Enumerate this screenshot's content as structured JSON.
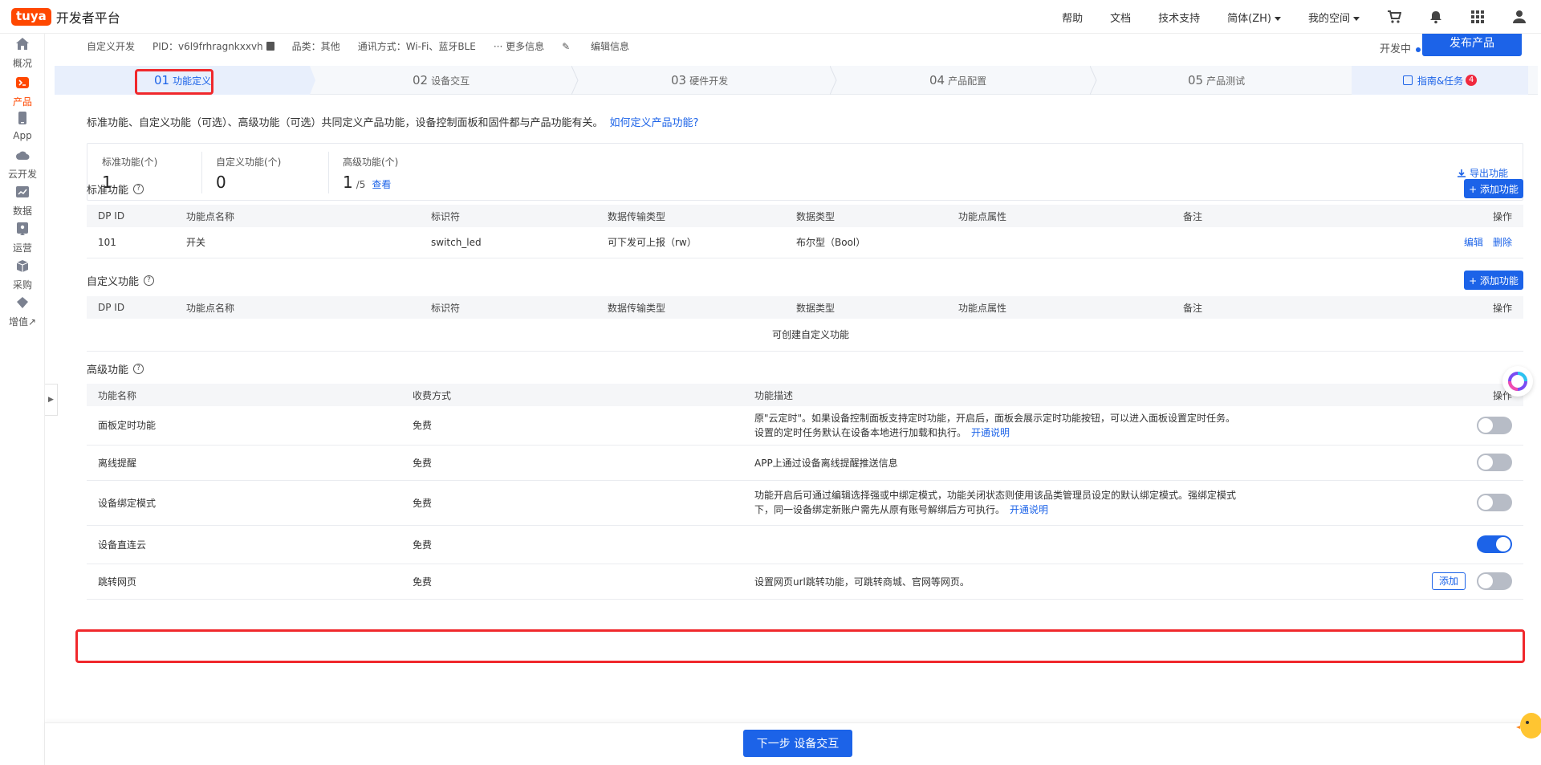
{
  "app": {
    "logo": "tuya",
    "title": "开发者平台"
  },
  "topnav": {
    "items": [
      "帮助",
      "文档",
      "技术支持",
      "简体(ZH)",
      "我的空间"
    ],
    "icons": [
      "cart-icon",
      "bell-icon",
      "apps-grid-icon",
      "user-icon"
    ]
  },
  "sidebar": {
    "items": [
      {
        "label": "概况",
        "icon": "home-icon"
      },
      {
        "label": "产品",
        "icon": "terminal-icon",
        "active": true
      },
      {
        "label": "App",
        "icon": "phone-icon"
      },
      {
        "label": "云开发",
        "icon": "cloud-icon"
      },
      {
        "label": "数据",
        "icon": "chart-icon"
      },
      {
        "label": "运营",
        "icon": "location-icon"
      },
      {
        "label": "采购",
        "icon": "box-icon"
      },
      {
        "label": "增值↗",
        "icon": "diamond-icon"
      }
    ]
  },
  "meta": {
    "dev_type": "自定义开发",
    "pid": "PID：v6l9frhragnkxxvh",
    "category": "品类：其他",
    "comm": "通讯方式：Wi-Fi、蓝牙BLE",
    "more": "··· 更多信息",
    "edit": "编辑信息",
    "status": "开发中",
    "publish": "发布产品"
  },
  "steps": [
    {
      "num": "01",
      "label": "功能定义",
      "active": true
    },
    {
      "num": "02",
      "label": "设备交互"
    },
    {
      "num": "03",
      "label": "硬件开发"
    },
    {
      "num": "04",
      "label": "产品配置"
    },
    {
      "num": "05",
      "label": "产品测试"
    }
  ],
  "guide": {
    "label": "指南&任务",
    "badge": "4"
  },
  "intro": {
    "text": "标准功能、自定义功能（可选）、高级功能（可选）共同定义产品功能，设备控制面板和固件都与产品功能有关。",
    "link": "如何定义产品功能?"
  },
  "stats": {
    "standard": {
      "title": "标准功能(个)",
      "value": "1"
    },
    "custom": {
      "title": "自定义功能(个)",
      "value": "0"
    },
    "advanced": {
      "title": "高级功能(个)",
      "value": "1",
      "total": "/5",
      "view": "查看"
    },
    "export": "导出功能"
  },
  "standard_section": {
    "title": "标准功能",
    "add": "+ 添加功能",
    "columns": [
      "DP ID",
      "功能点名称",
      "标识符",
      "数据传输类型",
      "数据类型",
      "功能点属性",
      "备注",
      "操作"
    ],
    "rows": [
      {
        "dp": "101",
        "name": "开关",
        "id": "switch_led",
        "trans": "可下发可上报（rw）",
        "dtype": "布尔型（Bool）",
        "attr": "",
        "note": "",
        "edit": "编辑",
        "delete": "删除"
      }
    ]
  },
  "custom_section": {
    "title": "自定义功能",
    "add": "+ 添加功能",
    "columns": [
      "DP ID",
      "功能点名称",
      "标识符",
      "数据传输类型",
      "数据类型",
      "功能点属性",
      "备注",
      "操作"
    ],
    "empty": "可创建自定义功能"
  },
  "advanced_section": {
    "title": "高级功能",
    "columns": [
      "功能名称",
      "收费方式",
      "功能描述",
      "操作"
    ],
    "rows": [
      {
        "name": "面板定时功能",
        "fee": "免费",
        "desc": "原\"云定时\"。如果设备控制面板支持定时功能，开启后，面板会展示定时功能按钮，可以进入面板设置定时任务。",
        "desc2": "设置的定时任务默认在设备本地进行加载和执行。",
        "link": "开通说明",
        "on": false
      },
      {
        "name": "离线提醒",
        "fee": "免费",
        "desc": "APP上通过设备离线提醒推送信息",
        "desc2": "",
        "link": "",
        "on": false
      },
      {
        "name": "设备绑定模式",
        "fee": "免费",
        "desc": "功能开启后可通过编辑选择强或中绑定模式，功能关闭状态则使用该品类管理员设定的默认绑定模式。强绑定模式",
        "desc2": "下，同一设备绑定新账户需先从原有账号解绑后方可执行。",
        "link": "开通说明",
        "on": false
      },
      {
        "name": "设备直连云",
        "fee": "免费",
        "desc": "",
        "desc2": "",
        "link": "",
        "on": true
      },
      {
        "name": "跳转网页",
        "fee": "免费",
        "desc": "设置网页url跳转功能，可跳转商城、官网等网页。",
        "desc2": "",
        "link": "",
        "on": false,
        "extra": "添加"
      }
    ]
  },
  "footer": {
    "next": "下一步 设备交互"
  },
  "colors": {
    "primary": "#1c63e8",
    "brand": "#ff4800",
    "highlight": "#f0282c"
  }
}
